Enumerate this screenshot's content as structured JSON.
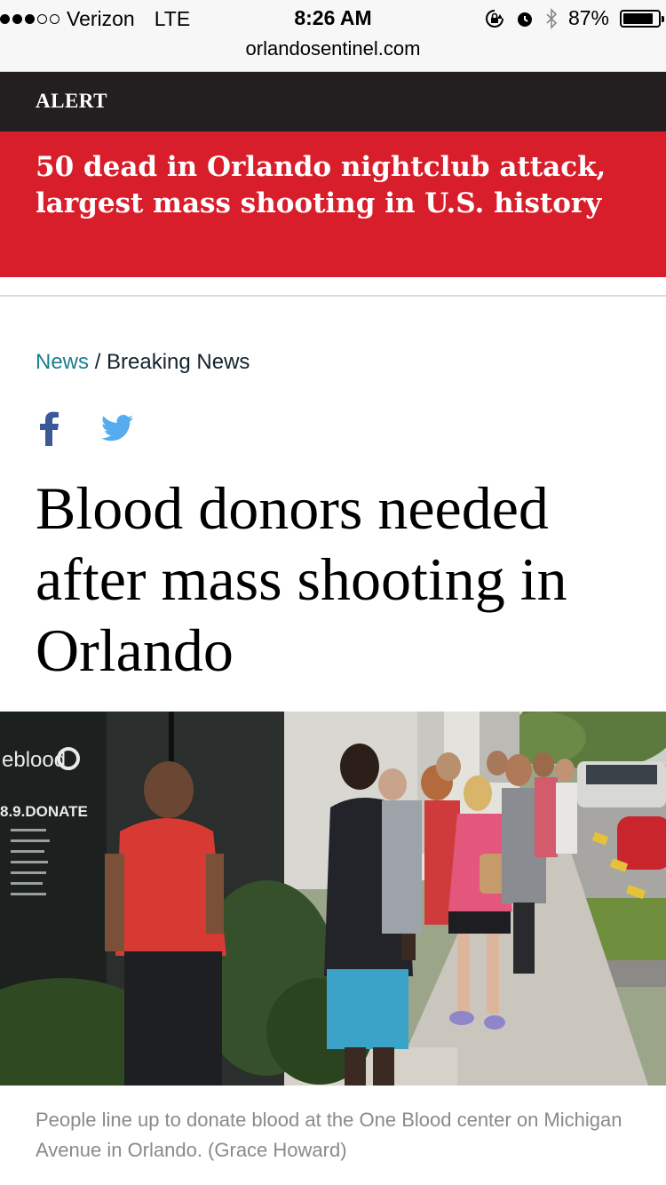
{
  "status_bar": {
    "carrier": "Verizon",
    "network": "LTE",
    "time": "8:26 AM",
    "battery_percent": "87%",
    "battery_level": 0.87,
    "signal_bars": 3,
    "signal_total": 5
  },
  "browser": {
    "url": "orlandosentinel.com"
  },
  "alert": {
    "label": "ALERT",
    "headline": "50 dead in Orlando nightclub attack, largest mass shooting in U.S. history",
    "background_color": "#d91e2b",
    "header_color": "#231f20"
  },
  "breadcrumb": {
    "section": "News",
    "separator": "/",
    "subsection": "Breaking News"
  },
  "share": {
    "icons": [
      "facebook-icon",
      "twitter-icon"
    ]
  },
  "article": {
    "title": "Blood donors needed after mass shooting in Orlando",
    "photo_sign_brand": "eblood",
    "photo_sign_phone": "8.9.DONATE",
    "photo_caption": "People line up to donate blood at the One Blood center on Michigan Avenue in Orlando. (Grace Howard)"
  },
  "colors": {
    "link": "#1a7f8e",
    "facebook": "#3b5998",
    "twitter": "#55acee"
  }
}
